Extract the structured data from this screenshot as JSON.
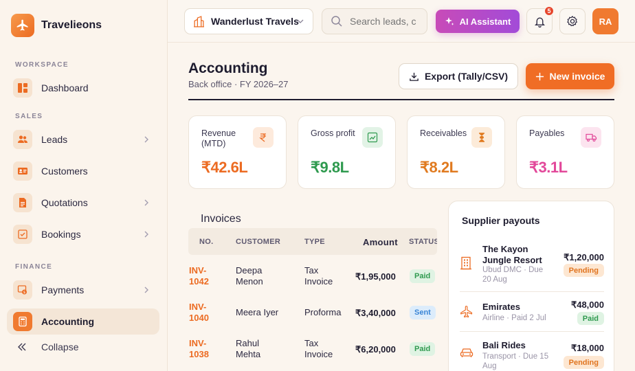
{
  "brand": {
    "name": "Travelieons"
  },
  "sidebar": {
    "sections": {
      "workspace": "WORKSPACE",
      "sales": "SALES",
      "finance": "FINANCE"
    },
    "items": [
      {
        "label": "Dashboard",
        "icon": "dashboard-icon"
      },
      {
        "label": "Leads",
        "icon": "users-icon"
      },
      {
        "label": "Customers",
        "icon": "id-card-icon"
      },
      {
        "label": "Quotations",
        "icon": "document-icon"
      },
      {
        "label": "Bookings",
        "icon": "calendar-check-icon"
      },
      {
        "label": "Payments",
        "icon": "payment-icon"
      },
      {
        "label": "Accounting",
        "icon": "calculator-icon"
      }
    ],
    "active": "Accounting",
    "collapse_label": "Collapse"
  },
  "topbar": {
    "workspace": "Wanderlust Travels",
    "search_placeholder": "Search leads, c",
    "ai_label": "AI Assistant",
    "notification_count": "5",
    "avatar_initials": "RA"
  },
  "page": {
    "title": "Accounting",
    "subtitle": "Back office · FY 2026–27",
    "export_label": "Export (Tally/CSV)",
    "new_label": "New invoice"
  },
  "kpis": [
    {
      "label": "Revenue (MTD)",
      "value": "₹42.6L",
      "color": "#ec6b22",
      "icon": "rupee-icon"
    },
    {
      "label": "Gross profit",
      "value": "₹9.8L",
      "color": "#2f9a4f",
      "icon": "trend-up-icon"
    },
    {
      "label": "Receivables",
      "value": "₹8.2L",
      "color": "#e07a1f",
      "icon": "hourglass-icon"
    },
    {
      "label": "Payables",
      "value": "₹3.1L",
      "color": "#e2489a",
      "icon": "truck-icon"
    }
  ],
  "invoices": {
    "title": "Invoices",
    "headers": {
      "no": "NO.",
      "customer": "CUSTOMER",
      "type": "TYPE",
      "amount": "Amount",
      "status": "STATUS"
    },
    "rows": [
      {
        "no1": "INV-",
        "no2": "1042",
        "cust1": "Deepa",
        "cust2": "Menon",
        "type1": "Tax",
        "type2": "Invoice",
        "amount": "₹1,95,000",
        "status": "Paid"
      },
      {
        "no1": "INV-",
        "no2": "1040",
        "cust1": "Meera Iyer",
        "cust2": "",
        "type1": "Proforma",
        "type2": "",
        "amount": "₹3,40,000",
        "status": "Sent"
      },
      {
        "no1": "INV-",
        "no2": "1038",
        "cust1": "Rahul",
        "cust2": "Mehta",
        "type1": "Tax",
        "type2": "Invoice",
        "amount": "₹6,20,000",
        "status": "Paid"
      }
    ]
  },
  "supplier_payouts": {
    "title": "Supplier payouts",
    "items": [
      {
        "name1": "The Kayon",
        "name2": "Jungle Resort",
        "meta1": "Ubud DMC · Due",
        "meta2": "20 Aug",
        "amount": "₹1,20,000",
        "status": "Pending",
        "icon": "building-icon"
      },
      {
        "name1": "Emirates",
        "name2": "",
        "meta1": "Airline · Paid 2 Jul",
        "meta2": "",
        "amount": "₹48,000",
        "status": "Paid",
        "icon": "plane-icon"
      },
      {
        "name1": "Bali Rides",
        "name2": "",
        "meta1": "Transport · Due 15",
        "meta2": "Aug",
        "amount": "₹18,000",
        "status": "Pending",
        "icon": "car-icon"
      }
    ]
  }
}
